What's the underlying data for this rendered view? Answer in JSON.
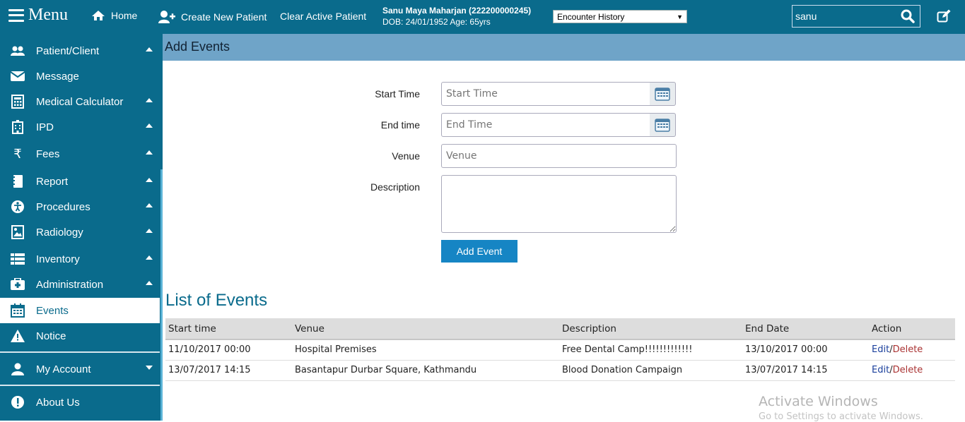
{
  "topbar": {
    "menu_label": "Menu",
    "home_label": "Home",
    "create_patient_label": "Create New Patient",
    "clear_patient_label": "Clear Active Patient",
    "patient_name": "Sanu Maya Maharjan (222200000245)",
    "patient_details": "DOB: 24/01/1952 Age: 65yrs",
    "encounter_select": "Encounter History",
    "search_value": "sanu"
  },
  "sidebar": {
    "items": [
      {
        "label": "Patient/Client",
        "icon": "users-icon"
      },
      {
        "label": "Message",
        "icon": "envelope-icon"
      },
      {
        "label": "Medical Calculator",
        "icon": "calculator-icon"
      },
      {
        "label": "IPD",
        "icon": "hospital-icon"
      },
      {
        "label": "Fees",
        "icon": "rupee-icon"
      },
      {
        "label": "Report",
        "icon": "book-icon"
      },
      {
        "label": "Procedures",
        "icon": "accessibility-icon"
      },
      {
        "label": "Radiology",
        "icon": "image-icon"
      },
      {
        "label": "Inventory",
        "icon": "list-icon"
      },
      {
        "label": "Administration",
        "icon": "medkit-icon"
      },
      {
        "label": "Events",
        "icon": "calendar-icon"
      },
      {
        "label": "Notice",
        "icon": "warning-icon"
      },
      {
        "label": "My Account",
        "icon": "user-icon"
      },
      {
        "label": "About Us",
        "icon": "info-icon"
      }
    ]
  },
  "page": {
    "title": "Add Events",
    "start_time_label": "Start Time",
    "start_time_placeholder": "Start Time",
    "end_time_label": "End time",
    "end_time_placeholder": "End Time",
    "venue_label": "Venue",
    "venue_placeholder": "Venue",
    "description_label": "Description",
    "add_button": "Add Event",
    "list_title": "List of Events"
  },
  "events_table": {
    "headers": [
      "Start time",
      "Venue",
      "Description",
      "End Date",
      "Action"
    ],
    "rows": [
      {
        "start": "11/10/2017 00:00",
        "venue": "Hospital Premises",
        "description": "Free Dental Camp!!!!!!!!!!!!!",
        "end": "13/10/2017 00:00",
        "edit": "Edit",
        "sep": "/",
        "delete": "Delete"
      },
      {
        "start": "13/07/2017 14:15",
        "venue": "Basantapur Durbar Square, Kathmandu",
        "description": "Blood Donation Campaign",
        "end": "13/07/2017 14:15",
        "edit": "Edit",
        "sep": "/",
        "delete": "Delete"
      }
    ]
  },
  "watermark": {
    "line1": "Activate Windows",
    "line2": "Go to Settings to activate Windows."
  },
  "colors": {
    "brand": "#0a6b8c",
    "header_bar": "#6fa4c8",
    "button": "#1685c4"
  }
}
